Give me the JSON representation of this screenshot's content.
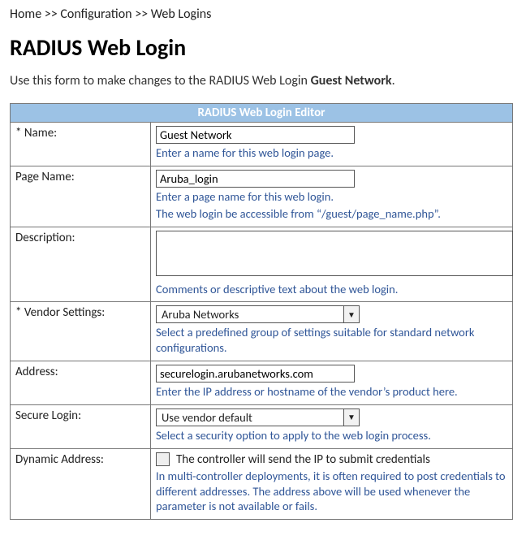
{
  "breadcrumb": {
    "items": [
      "Home",
      "Configuration",
      "Web Logins"
    ],
    "sep": ">>"
  },
  "title": "RADIUS Web Login",
  "intro_prefix": "Use this form to make changes to the RADIUS Web Login ",
  "intro_target": "Guest Network",
  "intro_suffix": ".",
  "editor_title": "RADIUS Web Login Editor",
  "fields": {
    "name": {
      "label": "* Name:",
      "value": "Guest Network",
      "hint": "Enter a name for this web login page."
    },
    "page_name": {
      "label": "Page Name:",
      "value": "Aruba_login",
      "hint1": "Enter a page name for this web login.",
      "hint2": "The web login be accessible from “/guest/page_name.php”."
    },
    "description": {
      "label": "Description:",
      "value": "",
      "hint": "Comments or descriptive text about the web login."
    },
    "vendor": {
      "label": "* Vendor Settings:",
      "value": "Aruba Networks",
      "hint": "Select a predefined group of settings suitable for standard network configurations."
    },
    "address": {
      "label": "Address:",
      "value": "securelogin.arubanetworks.com",
      "hint": "Enter the IP address or hostname of the vendor’s product here."
    },
    "secure_login": {
      "label": "Secure Login:",
      "value": "Use vendor default",
      "hint": "Select a security option to apply to the web login process."
    },
    "dynamic_address": {
      "label": "Dynamic Address:",
      "check_label": "The controller will send the IP to submit credentials",
      "hint": "In multi-controller deployments, it is often required to post credentials to different addresses. The address above will be used whenever the parameter is not available or fails."
    }
  }
}
